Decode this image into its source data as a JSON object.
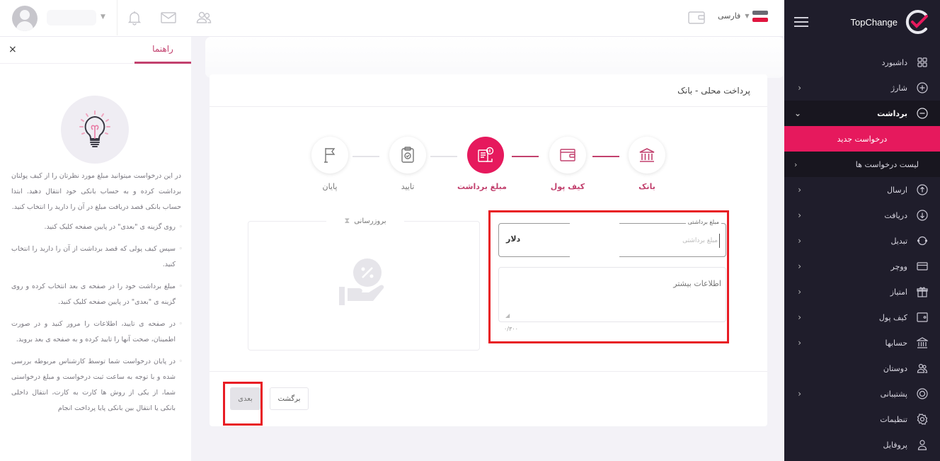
{
  "brand": {
    "name": "TopChange",
    "accent": "#e6195d",
    "sidebar_bg": "#1f1d2b"
  },
  "topbar": {
    "language": "فارسی",
    "icons": [
      "user-avatar",
      "bell-icon",
      "mail-icon",
      "users-icon",
      "wallet-icon",
      "flag-icon"
    ]
  },
  "sidebar": {
    "items": [
      {
        "label": "داشبورد",
        "icon": "dashboard-icon",
        "has_children": false
      },
      {
        "label": "شارژ",
        "icon": "plus-circle-icon",
        "has_children": true
      },
      {
        "label": "برداشت",
        "icon": "minus-circle-icon",
        "has_children": true,
        "open": true,
        "children": [
          {
            "label": "درخواست جدید",
            "active": true
          },
          {
            "label": "لیست درخواست ها",
            "active": false
          }
        ]
      },
      {
        "label": "ارسال",
        "icon": "arrow-up-circle-icon",
        "has_children": true
      },
      {
        "label": "دریافت",
        "icon": "arrow-down-circle-icon",
        "has_children": true
      },
      {
        "label": "تبدیل",
        "icon": "exchange-icon",
        "has_children": true
      },
      {
        "label": "ووچر",
        "icon": "card-icon",
        "has_children": true
      },
      {
        "label": "امتیاز",
        "icon": "gift-icon",
        "has_children": true
      },
      {
        "label": "کیف پول",
        "icon": "wallet-icon",
        "has_children": true
      },
      {
        "label": "حسابها",
        "icon": "bank-icon",
        "has_children": true
      },
      {
        "label": "دوستان",
        "icon": "users-icon",
        "has_children": false
      },
      {
        "label": "پشتیبانی",
        "icon": "support-icon",
        "has_children": true
      },
      {
        "label": "تنظیمات",
        "icon": "gear-icon",
        "has_children": false
      },
      {
        "label": "پروفایل",
        "icon": "user-icon",
        "has_children": false
      }
    ]
  },
  "help": {
    "tab": "راهنما",
    "close": "×",
    "intro": "در این درخواست میتوانید مبلغ مورد نظرتان را از کیف پولتان برداشت کرده و به حساب بانکی خود انتقال دهید. ابتدا حساب بانکی قصد دریافت مبلغ در آن را دارید را انتخاب کنید.",
    "steps": [
      "روی گزینه ی \"بعدی\" در پایین صفحه کلیک کنید.",
      "سپس کیف پولی که قصد برداشت از آن را دارید را انتخاب کنید.",
      "مبلغ برداشت خود را در صفحه ی بعد انتخاب کرده و روی گزینه ی \"بعدی\" در پایین صفحه کلیک کنید.",
      "در صفحه ی تایید، اطلاعات را مرور کنید و در صورت اطمینان، صحت آنها را تایید کرده و به صفحه ی بعد بروید.",
      "در پایان درخواست شما توسط کارشناس مربوطه بررسی شده و با توجه به ساعت ثبت درخواست و مبلغ درخواستی شما، از یکی از روش ها کارت به کارت، انتقال داخلی بانکی یا انتقال بین بانکی پایا پرداخت انجام"
    ]
  },
  "main": {
    "card_title": "پرداخت محلی - بانک",
    "steps": [
      {
        "label": "بانک",
        "icon": "bank-icon",
        "state": "done"
      },
      {
        "label": "کیف پول",
        "icon": "wallet-icon",
        "state": "done"
      },
      {
        "label": "مبلغ برداشت",
        "icon": "money-document-icon",
        "state": "current"
      },
      {
        "label": "تایید",
        "icon": "clipboard-check-icon",
        "state": "pending"
      },
      {
        "label": "پایان",
        "icon": "flag-icon",
        "state": "pending"
      }
    ],
    "form": {
      "amount_label": "مبلغ برداشتی",
      "amount_placeholder": "مبلغ برداشتی",
      "amount_value": "",
      "currency": "دلار",
      "notes_placeholder": "اطلاعات بیشتر",
      "notes_value": "",
      "char_counter": "۰/۳۰۰"
    },
    "rate_box": {
      "title": "بروزرسانی",
      "icon": "hourglass-icon",
      "image": "hand-percent-icon"
    },
    "buttons": {
      "next": "بعدی",
      "back": "برگشت"
    }
  }
}
